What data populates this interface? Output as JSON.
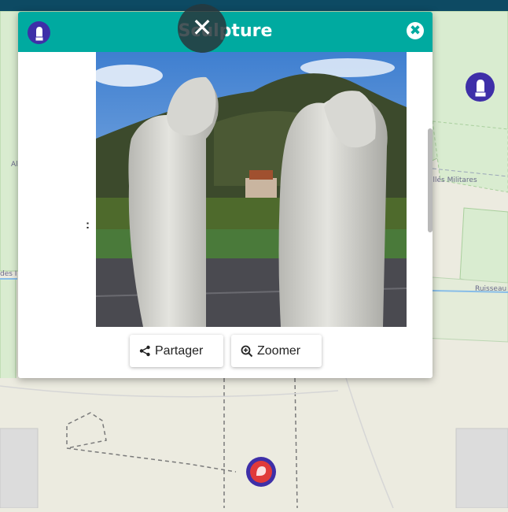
{
  "popup": {
    "title": "Sculpture",
    "close_symbol": "✖",
    "header_icon": "statue-marker-icon",
    "detail_colon": ":",
    "photo_alt": "Deux sculptures en pierre blanche"
  },
  "overlay": {
    "close_symbol": "✕"
  },
  "buttons": {
    "share_label": "Partager",
    "share_icon": "share-icon",
    "zoom_label": "Zoomer",
    "zoom_icon": "zoom-in-icon"
  },
  "map": {
    "labels": {
      "street_right": "allés Militares",
      "street_left_top": "Al",
      "street_left_mid": "des I",
      "stream": "Ruisseau"
    }
  },
  "colors": {
    "header": "#00aaa0",
    "topbar": "#0d4a63",
    "marker_blue": "#3e2fa8",
    "marker_red": "#e03a3a"
  }
}
